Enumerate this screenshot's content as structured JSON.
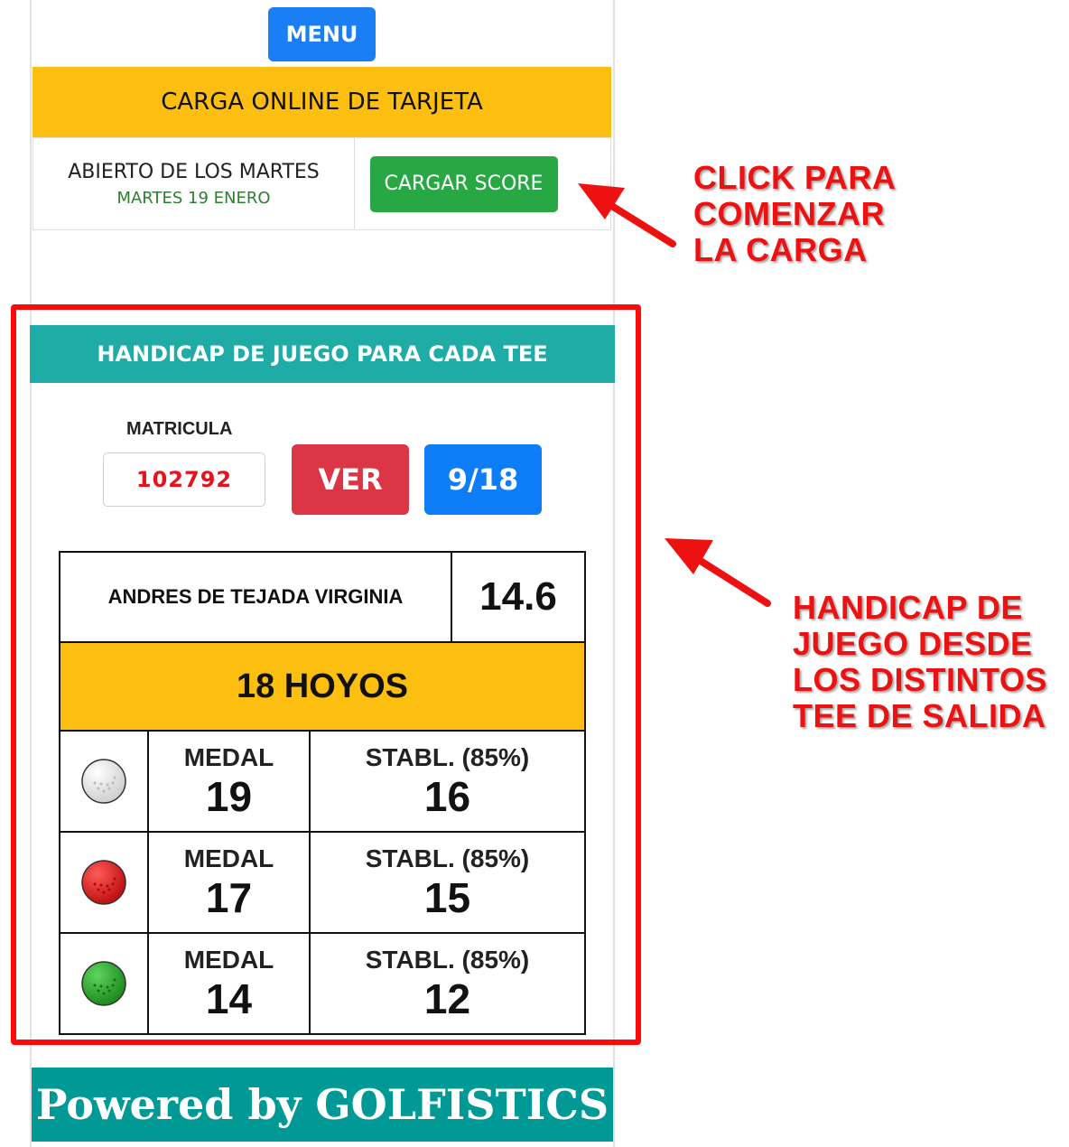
{
  "header": {
    "menu_label": "MENU"
  },
  "tarjeta": {
    "banner": "CARGA ONLINE DE TARJETA",
    "event_name": "ABIERTO DE LOS MARTES",
    "event_date": "MARTES 19 ENERO",
    "cargar_label": "CARGAR SCORE"
  },
  "annotations": {
    "click": [
      "CLICK PARA",
      "COMENZAR",
      "LA CARGA"
    ],
    "handicap": [
      "HANDICAP DE",
      "JUEGO DESDE",
      "LOS DISTINTOS",
      "TEE DE SALIDA"
    ]
  },
  "handicap": {
    "header": "HANDICAP DE JUEGO PARA CADA TEE",
    "matricula_label": "MATRICULA",
    "matricula_value": "102792",
    "ver_label": "VER",
    "holes_toggle_label": "9/18",
    "player_name": "ANDRES DE TEJADA VIRGINIA",
    "player_index": "14.6",
    "holes_title": "18 HOYOS",
    "tees": [
      {
        "ball": "white-ball-icon",
        "color": "#f2f2f2",
        "medal_label": "MEDAL",
        "medal": "19",
        "stab_label": "STABL. (85%)",
        "stab": "16"
      },
      {
        "ball": "red-ball-icon",
        "color": "#e02020",
        "medal_label": "MEDAL",
        "medal": "17",
        "stab_label": "STABL. (85%)",
        "stab": "15"
      },
      {
        "ball": "green-ball-icon",
        "color": "#2aa52a",
        "medal_label": "MEDAL",
        "medal": "14",
        "stab_label": "STABL. (85%)",
        "stab": "12"
      }
    ]
  },
  "footer": {
    "powered": "Powered by GOLFISTICS"
  },
  "colors": {
    "teal": "#20aca6",
    "yellow": "#fdbf0f",
    "annotation_red": "#ee1111"
  }
}
